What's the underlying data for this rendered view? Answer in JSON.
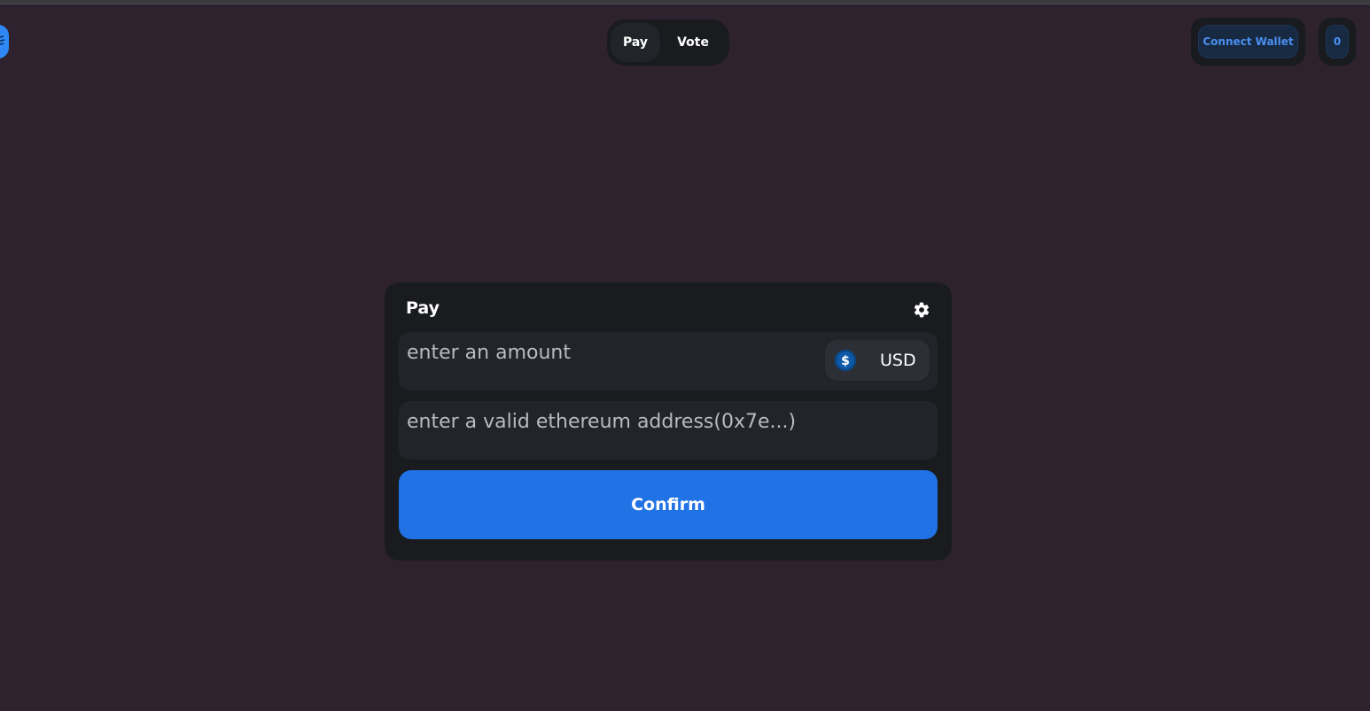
{
  "nav": {
    "tabs": [
      {
        "label": "Pay",
        "active": true
      },
      {
        "label": "Vote",
        "active": false
      }
    ]
  },
  "header": {
    "connect_wallet_label": "Connect Wallet",
    "count_label": "0"
  },
  "card": {
    "title": "Pay",
    "amount_placeholder": "enter an amount",
    "address_placeholder": "enter a valid ethereum address(0x7e...)",
    "currency": {
      "label": "USD",
      "icon": "dollar-coin-icon"
    },
    "confirm_label": "Confirm"
  },
  "colors": {
    "background": "#2e222f",
    "card": "#191b1f",
    "field": "#212429",
    "accent": "#2172e5",
    "wallet_text": "#4b8ff0"
  }
}
